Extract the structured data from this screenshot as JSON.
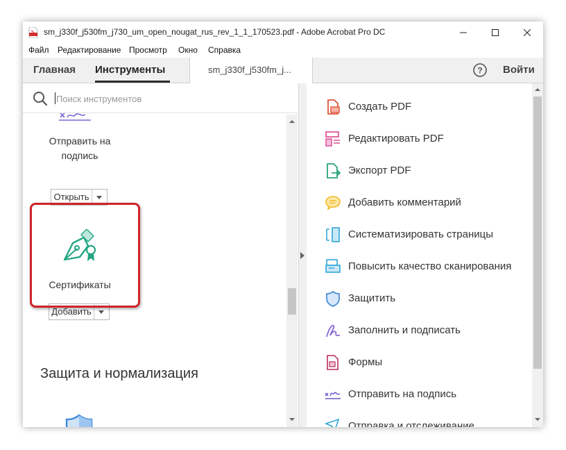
{
  "window": {
    "title": "sm_j330f_j530fm_j730_um_open_nougat_rus_rev_1_1_170523.pdf - Adobe Acrobat Pro DC",
    "app_icon": "acrobat-pdf-icon",
    "controls": [
      "minimize-icon",
      "maximize-icon",
      "close-icon"
    ]
  },
  "menu": {
    "file": "Файл",
    "edit": "Редактирование",
    "view": "Просмотр",
    "window": "Окно",
    "help": "Справка"
  },
  "tabs": {
    "home": "Главная",
    "tools": "Инструменты",
    "document": "sm_j330f_j530fm_j...",
    "active": "Инструменты",
    "help_icon": "help-circle-icon",
    "sign_in": "Войти"
  },
  "left_panel": {
    "search": {
      "placeholder": "Поиск инструментов",
      "value": "",
      "icon": "search-icon"
    },
    "send_for_signature": {
      "label_line1": "Отправить на",
      "label_line2": "подпись",
      "button": "Открыть"
    },
    "certificates": {
      "label": "Сертификаты",
      "button": "Добавить",
      "icon": "certificate-pen-icon",
      "highlight_color": "#d0222a"
    },
    "section_title": "Защита и нормализация",
    "shield_icon": "shield-icon"
  },
  "right_panel": {
    "tools": [
      {
        "label": "Создать PDF",
        "icon": "create-pdf-icon",
        "color": "#e0533b"
      },
      {
        "label": "Редактировать PDF",
        "icon": "edit-pdf-icon",
        "color": "#e05a9a"
      },
      {
        "label": "Экспорт PDF",
        "icon": "export-pdf-icon",
        "color": "#2aa67a"
      },
      {
        "label": "Добавить комментарий",
        "icon": "comment-icon",
        "color": "#f2b824"
      },
      {
        "label": "Систематизировать страницы",
        "icon": "organize-pages-icon",
        "color": "#2fa6d9"
      },
      {
        "label": "Повысить качество сканирования",
        "icon": "enhance-scan-icon",
        "color": "#2fa6d9"
      },
      {
        "label": "Защитить",
        "icon": "protect-shield-icon",
        "color": "#4a8fd6"
      },
      {
        "label": "Заполнить и подписать",
        "icon": "fill-sign-icon",
        "color": "#8b6ad6"
      },
      {
        "label": "Формы",
        "icon": "forms-icon",
        "color": "#c2466f"
      },
      {
        "label": "Отправить на подпись",
        "icon": "send-signature-icon",
        "color": "#6a57c9"
      },
      {
        "label": "Отправка и отслеживание",
        "icon": "send-track-icon",
        "color": "#2fa6d9"
      }
    ]
  }
}
